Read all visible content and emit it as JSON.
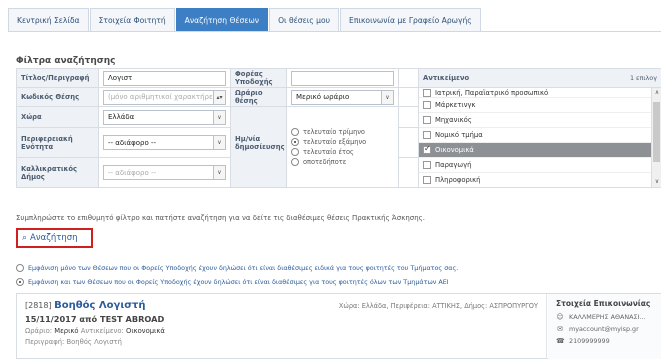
{
  "tabs": [
    {
      "label": "Κεντρική Σελίδα"
    },
    {
      "label": "Στοιχεία Φοιτητή"
    },
    {
      "label": "Αναζήτηση Θέσεων"
    },
    {
      "label": "Οι θέσεις μου"
    },
    {
      "label": "Επικοινωνία με Γραφείο Αρωγής"
    }
  ],
  "active_tab": "Αναζήτηση Θέσεων",
  "filters": {
    "title": "Φίλτρα αναζήτησης",
    "title_label": "Τίτλος/Περιγραφή",
    "title_value": "Λογιστ",
    "provider_label": "Φορέας Υποδοχής",
    "provider_value": "",
    "code_label": "Κωδικός Θέσης",
    "code_placeholder": "(μόνο αριθμητικοί χαρακτήρες)",
    "hours_label": "Ωράριο θέσης",
    "hours_value": "Μερικό ωράριο",
    "country_label": "Χώρα",
    "country_value": "Ελλάδα",
    "region_label": "Περιφερειακή Ενότητα",
    "region_value": "-- αδιάφορο --",
    "date_label": "Ημ/νία δημοσίευσης",
    "municipality_label": "Καλλικρατικός Δήμος",
    "municipality_value": "-- αδιάφορο --",
    "date_options": [
      {
        "label": "τελευταίο τρίμηνο",
        "checked": false
      },
      {
        "label": "τελευταίο εξάμηνο",
        "checked": true
      },
      {
        "label": "τελευταίο έτος",
        "checked": false
      },
      {
        "label": "οποτεδήποτε",
        "checked": false
      }
    ],
    "objects_label": "Αντικείμενο",
    "objects_count": "1 επιλογ",
    "objects": [
      {
        "label": "Ιατρική, Παραϊατρικό προσωπικό",
        "checked": false
      },
      {
        "label": "Μάρκετινγκ",
        "checked": false
      },
      {
        "label": "Μηχανικός",
        "checked": false
      },
      {
        "label": "Νομικό τμήμα",
        "checked": false
      },
      {
        "label": "Οικονομικά",
        "checked": true
      },
      {
        "label": "Παραγωγή",
        "checked": false
      },
      {
        "label": "Πληροφορική",
        "checked": false
      }
    ]
  },
  "hint_text": "Συμπληρώστε το επιθυμητό φίλτρο και πατήστε αναζήτηση για να δείτε τις διαθέσιμες θέσεις Πρακτικής Άσκησης.",
  "search_button": "Αναζήτηση",
  "visibility_options": [
    {
      "label": "Εμφάνιση μόνο των Θέσεων που οι Φορείς Υποδοχής έχουν δηλώσει ότι είναι διαθέσιμες ειδικά για τους φοιτητές του Τμήματος σας.",
      "checked": false
    },
    {
      "label": "Εμφάνιση και των Θέσεων που οι Φορείς Υποδοχής έχουν δηλώσει ότι είναι διαθέσιμες για τους φοιτητές όλων των Τμημάτων ΑΕΙ",
      "checked": true
    }
  ],
  "result": {
    "id": "[2818]",
    "title": "Βοηθός Λογιστή",
    "location": "Χώρα: Ελλάδα, Περιφέρεια: ΑΤΤΙΚΗΣ, Δήμος: ΑΣΠΡΟΠΥΡΓΟΥ",
    "date_company": "15/11/2017 από TEST ABROAD",
    "hours_label": "Ωράριο:",
    "hours_value": "Μερικό",
    "object_label": "Αντικείμενο:",
    "object_value": "Οικονομικά",
    "description_label": "Περιγραφή:",
    "description_value": "Βοηθός Λογιστή",
    "contact_title": "Στοιχεία Επικοινωνίας",
    "contact_name": "ΚΑΛΛΜΕΡΗΣ ΑΘΑΝΑΣΙ...",
    "contact_email": "myaccount@myisp.gr",
    "contact_phone": "2109999999"
  }
}
